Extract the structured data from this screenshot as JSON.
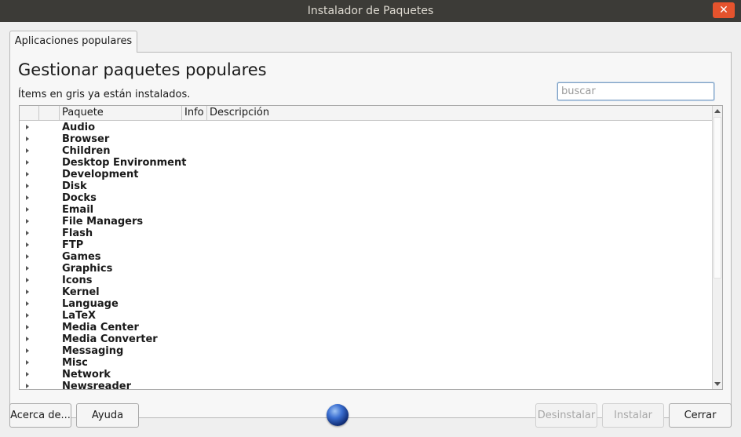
{
  "window": {
    "title": "Instalador de Paquetes"
  },
  "tabs": [
    {
      "label": "Aplicaciones populares"
    }
  ],
  "main": {
    "heading": "Gestionar paquetes populares",
    "subtext": "Ítems en gris ya están instalados.",
    "search": {
      "placeholder": "buscar",
      "value": ""
    }
  },
  "table": {
    "columns": [
      "",
      "",
      "Paquete",
      "Info",
      "Descripción"
    ],
    "rows": [
      "Audio",
      "Browser",
      "Children",
      "Desktop Environment",
      "Development",
      "Disk",
      "Docks",
      "Email",
      "File Managers",
      "Flash",
      "FTP",
      "Games",
      "Graphics",
      "Icons",
      "Kernel",
      "Language",
      "LaTeX",
      "Media Center",
      "Media Converter",
      "Messaging",
      "Misc",
      "Network",
      "Newsreader"
    ]
  },
  "buttons": {
    "about": "Acerca de...",
    "help": "Ayuda",
    "uninstall": "Desinstalar",
    "install": "Instalar",
    "close": "Cerrar"
  },
  "icons": {
    "close": "close-icon",
    "globe": "globe-icon",
    "expander": "triangle-right-icon"
  },
  "colors": {
    "titlebar": "#3c3b37",
    "close_button": "#e5532d",
    "window_bg": "#efefef"
  }
}
